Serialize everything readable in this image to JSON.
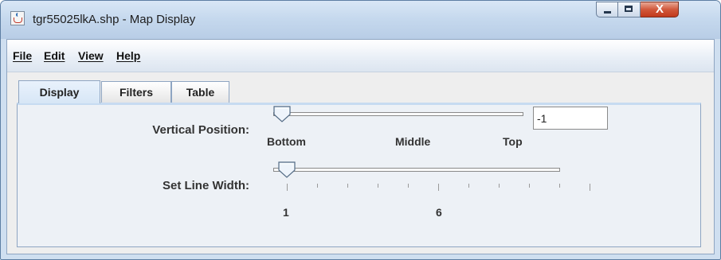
{
  "window": {
    "title": "tgr55025lkA.shp - Map Display",
    "controls": {
      "minimize": "minimize",
      "maximize": "maximize",
      "close_glyph": "X"
    }
  },
  "menu": {
    "items": [
      "File",
      "Edit",
      "View",
      "Help"
    ]
  },
  "tabs": {
    "items": [
      "Display",
      "Filters",
      "Table"
    ],
    "active": "Display"
  },
  "display_panel": {
    "vertical_position": {
      "label": "Vertical Position:",
      "value": "-1",
      "tick_labels": [
        "Bottom",
        "Middle",
        "Top"
      ],
      "slider_fraction": 0
    },
    "line_width": {
      "label": "Set Line Width:",
      "tick_labels": [
        "1",
        "6"
      ],
      "min": 1,
      "value": 1,
      "major_every": 5,
      "minor_ticks": 11
    }
  },
  "icons": {
    "app": "java-cup-icon",
    "minimize": "minimize-icon",
    "maximize": "maximize-icon",
    "close": "close-icon",
    "slider_thumb": "slider-thumb-icon"
  }
}
